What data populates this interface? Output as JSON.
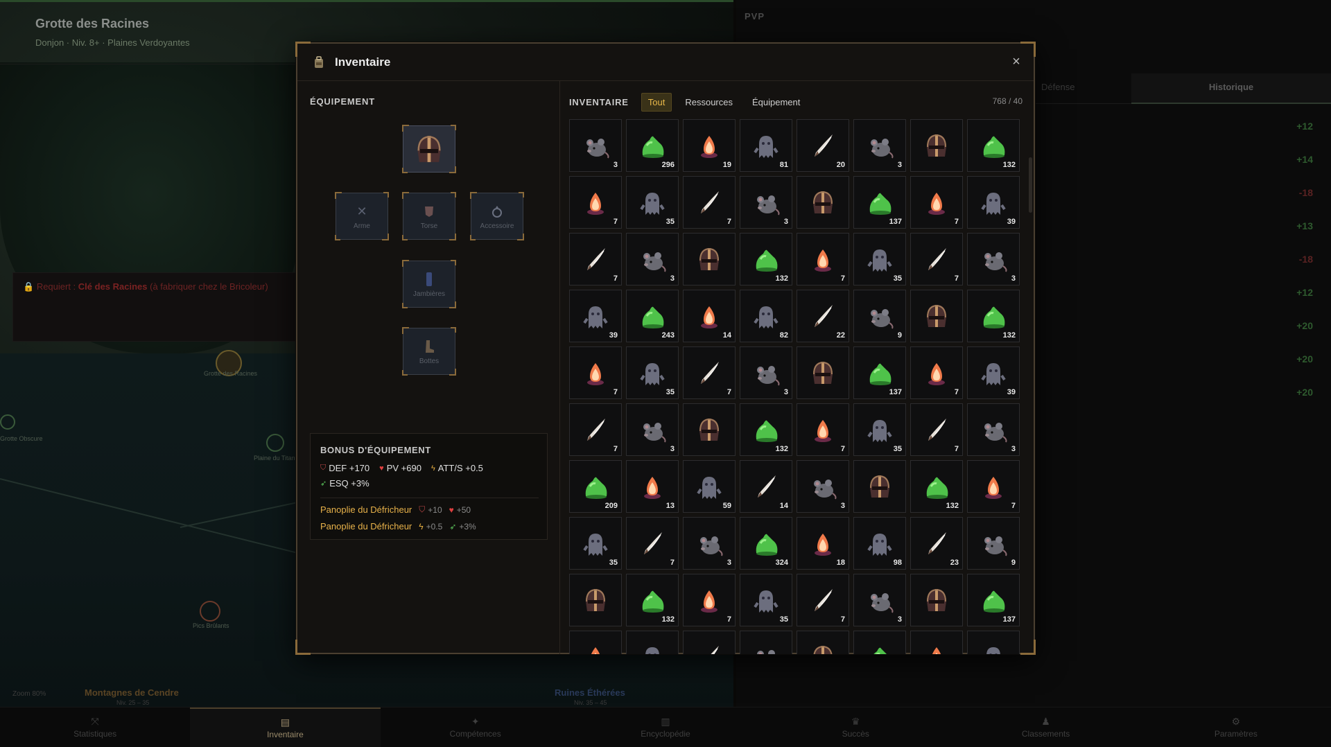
{
  "background": {
    "location_title": "Grotte des Racines",
    "location_sub": "Donjon · Niv. 8+ · Plaines Verdoyantes",
    "requirement_prefix": "Requiert : ",
    "requirement_item": "Clé des Racines",
    "requirement_suffix": " (à fabriquer chez le Bricoleur)",
    "map_labels": [
      "Grotte des Racines",
      "Grotte Obscure",
      "Plaine du Titan",
      "Pics Brûlants"
    ],
    "regions": [
      {
        "name": "Montagnes de Cendre",
        "level": "Niv. 25 – 35",
        "color": "#5a4424"
      },
      {
        "name": "Ruines Éthérées",
        "level": "Niv. 35 – 45",
        "color": "#2a3a5a"
      }
    ],
    "zoom": "Zoom 80%",
    "pvp_title": "PVP",
    "pvp_tab_other": "Défense",
    "pvp_tab_history": "Historique",
    "history_values": [
      {
        "v": "+12",
        "c": "#2e5a2e"
      },
      {
        "v": "+14",
        "c": "#2e5a2e"
      },
      {
        "v": "-18",
        "c": "#5a2222"
      },
      {
        "v": "+13",
        "c": "#2e5a2e"
      },
      {
        "v": "-18",
        "c": "#5a2222"
      },
      {
        "v": "+12",
        "c": "#2e5a2e"
      },
      {
        "v": "+20",
        "c": "#2e5a2e"
      },
      {
        "v": "+20",
        "c": "#2e5a2e"
      },
      {
        "v": "+20",
        "c": "#2e5a2e"
      }
    ]
  },
  "nav": [
    {
      "label": "Statistiques",
      "icon": "stats-icon"
    },
    {
      "label": "Inventaire",
      "icon": "backpack-icon",
      "active": true
    },
    {
      "label": "Compétences",
      "icon": "skills-icon"
    },
    {
      "label": "Encyclopédie",
      "icon": "book-icon"
    },
    {
      "label": "Succès",
      "icon": "trophy-icon"
    },
    {
      "label": "Classements",
      "icon": "ranking-icon"
    },
    {
      "label": "Paramètres",
      "icon": "gear-icon"
    }
  ],
  "modal": {
    "title": "Inventaire",
    "close": "×",
    "equipment": {
      "heading": "ÉQUIPEMENT",
      "slots": {
        "head": {
          "label": "",
          "item": "helmet"
        },
        "weapon": {
          "label": "Arme",
          "icon": "swords-icon"
        },
        "torso": {
          "label": "Torse",
          "icon": "chestplate-icon"
        },
        "accessory": {
          "label": "Accessoire",
          "icon": "ring-icon"
        },
        "legs": {
          "label": "Jambières",
          "icon": "greaves-icon"
        },
        "boots": {
          "label": "Bottes",
          "icon": "boot-icon"
        }
      },
      "bonus": {
        "title": "BONUS D'ÉQUIPEMENT",
        "def": "DEF +170",
        "pv": "PV +690",
        "atts": "ATT/S +0.5",
        "esq": "ESQ +3%",
        "sets": [
          {
            "name": "Panoplie du Défricheur",
            "a": "+10",
            "b": "+50",
            "ia": "shield",
            "ib": "heart"
          },
          {
            "name": "Panoplie du Défricheur",
            "a": "+0.5",
            "b": "+3%",
            "ia": "bolt",
            "ib": "dodge"
          }
        ]
      }
    },
    "inventory": {
      "label": "INVENTAIRE",
      "filters": [
        "Tout",
        "Ressources",
        "Équipement"
      ],
      "active_filter": "Tout",
      "capacity": "768 / 40",
      "items": [
        [
          "rat",
          3
        ],
        [
          "slime",
          296
        ],
        [
          "flame",
          19
        ],
        [
          "ghost",
          81
        ],
        [
          "fang",
          20
        ],
        [
          "rat",
          3
        ],
        [
          "helmet",
          ""
        ],
        [
          "slime",
          132
        ],
        [
          "flame",
          7
        ],
        [
          "ghost",
          35
        ],
        [
          "fang",
          7
        ],
        [
          "rat",
          3
        ],
        [
          "helmet",
          ""
        ],
        [
          "slime",
          137
        ],
        [
          "flame",
          7
        ],
        [
          "ghost",
          39
        ],
        [
          "fang",
          7
        ],
        [
          "rat",
          3
        ],
        [
          "helmet",
          ""
        ],
        [
          "slime",
          132
        ],
        [
          "flame",
          7
        ],
        [
          "ghost",
          35
        ],
        [
          "fang",
          7
        ],
        [
          "rat",
          3
        ],
        [
          "ghost",
          39
        ],
        [
          "slime",
          243
        ],
        [
          "flame",
          14
        ],
        [
          "ghost",
          82
        ],
        [
          "fang",
          22
        ],
        [
          "rat",
          9
        ],
        [
          "helmet",
          ""
        ],
        [
          "slime",
          132
        ],
        [
          "flame",
          7
        ],
        [
          "ghost",
          35
        ],
        [
          "fang",
          7
        ],
        [
          "rat",
          3
        ],
        [
          "helmet",
          ""
        ],
        [
          "slime",
          137
        ],
        [
          "flame",
          7
        ],
        [
          "ghost",
          39
        ],
        [
          "fang",
          7
        ],
        [
          "rat",
          3
        ],
        [
          "helmet",
          ""
        ],
        [
          "slime",
          132
        ],
        [
          "flame",
          7
        ],
        [
          "ghost",
          35
        ],
        [
          "fang",
          7
        ],
        [
          "rat",
          3
        ],
        [
          "slime",
          209
        ],
        [
          "flame",
          13
        ],
        [
          "ghost",
          59
        ],
        [
          "fang",
          14
        ],
        [
          "rat",
          3
        ],
        [
          "helmet",
          ""
        ],
        [
          "slime",
          132
        ],
        [
          "flame",
          7
        ],
        [
          "ghost",
          35
        ],
        [
          "fang",
          7
        ],
        [
          "rat",
          3
        ],
        [
          "slime",
          324
        ],
        [
          "flame",
          18
        ],
        [
          "ghost",
          98
        ],
        [
          "fang",
          23
        ],
        [
          "rat",
          9
        ],
        [
          "helmet",
          ""
        ],
        [
          "slime",
          132
        ],
        [
          "flame",
          7
        ],
        [
          "ghost",
          35
        ],
        [
          "fang",
          7
        ],
        [
          "rat",
          3
        ],
        [
          "helmet",
          ""
        ],
        [
          "slime",
          137
        ],
        [
          "flame",
          ""
        ],
        [
          "ghost",
          ""
        ],
        [
          "fang",
          ""
        ],
        [
          "rat",
          ""
        ],
        [
          "helmet",
          ""
        ],
        [
          "slime",
          ""
        ],
        [
          "flame",
          ""
        ],
        [
          "ghost",
          ""
        ]
      ]
    }
  }
}
